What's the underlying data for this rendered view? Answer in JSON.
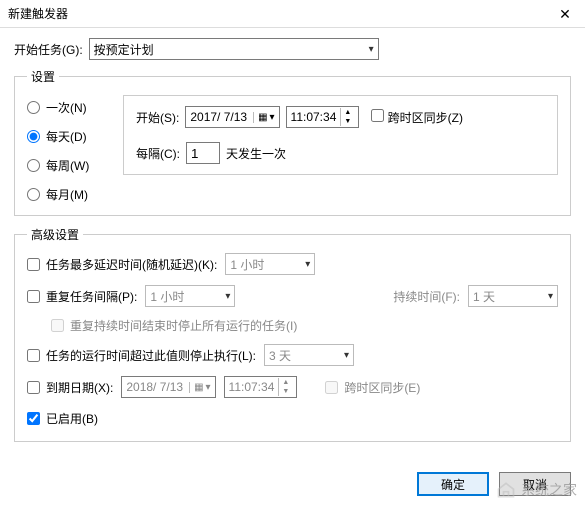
{
  "title": "新建触发器",
  "close_glyph": "✕",
  "begin_task": {
    "label": "开始任务(G):",
    "value": "按预定计划"
  },
  "settings": {
    "legend": "设置",
    "schedules": {
      "once": "一次(N)",
      "daily": "每天(D)",
      "weekly": "每周(W)",
      "monthly": "每月(M)"
    },
    "start_label": "开始(S):",
    "start_date": "2017/ 7/13",
    "start_time": "11:07:34",
    "sync_tz": "跨时区同步(Z)",
    "recur_label": "每隔(C):",
    "recur_value": "1",
    "recur_suffix": "天发生一次"
  },
  "advanced": {
    "legend": "高级设置",
    "delay": {
      "label": "任务最多延迟时间(随机延迟)(K):",
      "value": "1 小时"
    },
    "repeat": {
      "label": "重复任务间隔(P):",
      "value": "1 小时",
      "duration_label": "持续时间(F):",
      "duration_value": "1 天",
      "stop_all": "重复持续时间结束时停止所有运行的任务(I)"
    },
    "stop_if": {
      "label": "任务的运行时间超过此值则停止执行(L):",
      "value": "3 天"
    },
    "expire": {
      "label": "到期日期(X):",
      "date": "2018/ 7/13",
      "time": "11:07:34",
      "sync_tz": "跨时区同步(E)"
    },
    "enabled": "已启用(B)"
  },
  "buttons": {
    "ok": "确定",
    "cancel": "取消"
  },
  "watermark": "系统之家"
}
